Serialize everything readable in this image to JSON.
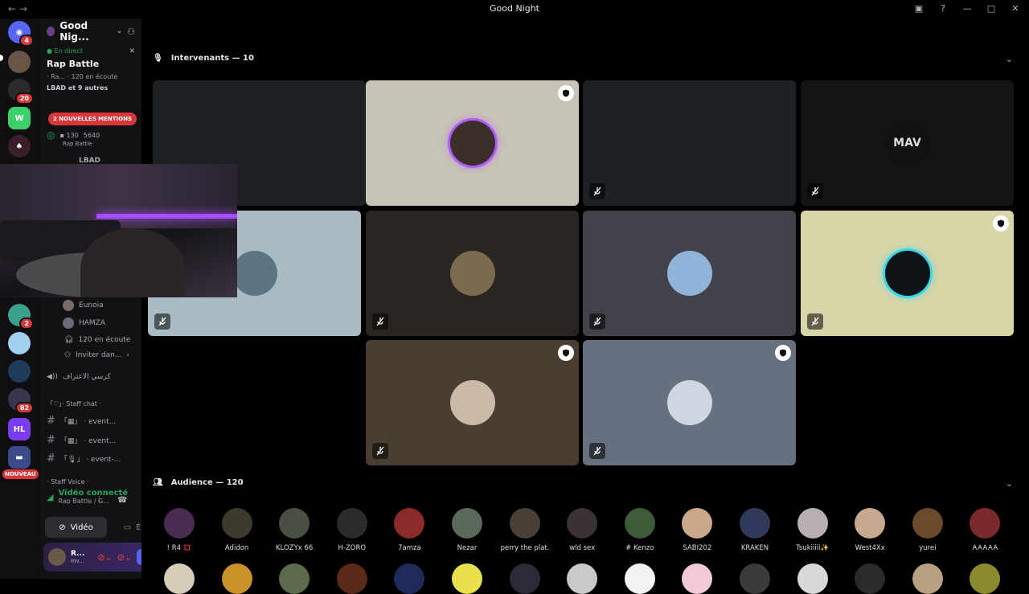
{
  "window": {
    "title": "Good Night"
  },
  "rail": {
    "badges": [
      "4",
      "20",
      "2",
      "82"
    ],
    "new_label": "NOUVEAU"
  },
  "sidebar": {
    "server_name": "Good Nig...",
    "live": {
      "status": "En direct",
      "title": "Rap Battle",
      "meta": "· Ra... · 120 en écoute",
      "speakers": "LBAD et 9 autres"
    },
    "mentions": "2 NOUVELLES MENTIONS",
    "stage_item": {
      "count_video": "130",
      "count_other": "5640",
      "sub": "Rap Battle"
    },
    "lbad": "LBAD",
    "members": [
      {
        "name": "Eunoia"
      },
      {
        "name": "HAMZA"
      }
    ],
    "listening": "120 en écoute",
    "invite": "Inviter dan...",
    "channels": [
      {
        "label": "كرسي الاعتراف"
      },
      {
        "label": "「♡」· Staff chat ·"
      },
      {
        "label": "「▦」 · event..."
      },
      {
        "label": "「▦」 · event..."
      },
      {
        "label": "「🎙」 · event-..."
      },
      {
        "label": "· Staff Voice ·"
      }
    ],
    "voice": {
      "connected": "Vidéo connecté",
      "sub": "Rap Battle / G..."
    },
    "video_btn": "Vidéo",
    "screen_btn": "Écran",
    "user": {
      "name": "R...",
      "sub": "Inv..."
    }
  },
  "speakers_section": {
    "title": "Intervenants — 10"
  },
  "audience_section": {
    "title": "Audience — 120"
  },
  "tiles": [
    {
      "bg": "#1e2124",
      "av": "",
      "mute": false,
      "mod": false
    },
    {
      "bg": "#c7c4b5",
      "av": "#3b2f2a",
      "mute": false,
      "mod": true,
      "ring": "#b15cff"
    },
    {
      "bg": "#1e2124",
      "av": "",
      "mute": true,
      "mod": false
    },
    {
      "bg": "#121416",
      "av": "#111",
      "mute": true,
      "mod": false,
      "logo": "MAV"
    },
    {
      "bg": "#a9bcc6",
      "av": "#5e7480",
      "mute": true,
      "mod": false
    },
    {
      "bg": "#2a2520",
      "av": "#7a6a50",
      "mute": true,
      "mod": false
    },
    {
      "bg": "#41424a",
      "av": "#8fb3d9",
      "mute": true,
      "mod": false
    },
    {
      "bg": "#d8d5a8",
      "av": "#0e1418",
      "mute": true,
      "mod": true,
      "ring": "#38d7e8"
    },
    {
      "bg": "#4a3e30",
      "av": "#c9b9a8",
      "mute": true,
      "mod": true
    },
    {
      "bg": "#66707e",
      "av": "#cfd6e0",
      "mute": true,
      "mod": true
    }
  ],
  "audience": [
    {
      "name": "! R4 💢",
      "color": "#4a2c52"
    },
    {
      "name": "Adidon",
      "color": "#3d3a2c"
    },
    {
      "name": "KLOZYx 66",
      "color": "#4a4f44"
    },
    {
      "name": "H-ZORO",
      "color": "#2b2b2b"
    },
    {
      "name": "7amza",
      "color": "#8a2a2a"
    },
    {
      "name": "Nezar",
      "color": "#5a6a5a"
    },
    {
      "name": "perry the plat...",
      "color": "#4a3f35"
    },
    {
      "name": "wld sex",
      "color": "#3a3232"
    },
    {
      "name": "# Kenzo",
      "color": "#3e5a3a"
    },
    {
      "name": "SABI202",
      "color": "#c9a98a"
    },
    {
      "name": "KRAKEN",
      "color": "#2f3a5a"
    },
    {
      "name": "Tsukiiiii✨",
      "color": "#b8b0b0"
    },
    {
      "name": "West4Xx",
      "color": "#c7a890"
    },
    {
      "name": "yurei",
      "color": "#6b4a2a"
    },
    {
      "name": "𐌀𐌀𐌀𐌀𐌀",
      "color": "#7a2a2a"
    }
  ]
}
